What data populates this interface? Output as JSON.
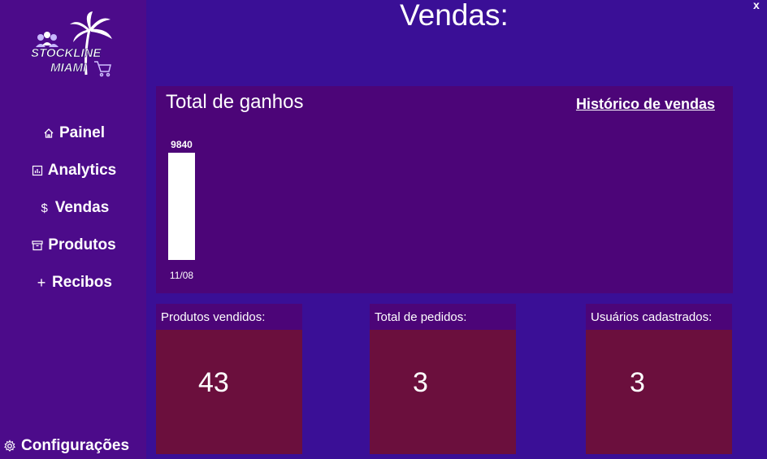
{
  "header": {
    "title": "Vendas:",
    "close_label": "x"
  },
  "logo": {
    "line1": "STOCKLINE",
    "line2": "MIAMI"
  },
  "sidebar": {
    "items": [
      {
        "label": "Painel",
        "icon": "home-icon"
      },
      {
        "label": "Analytics",
        "icon": "bar-chart-icon"
      },
      {
        "label": "Vendas",
        "icon": "dollar-icon"
      },
      {
        "label": "Produtos",
        "icon": "archive-box-icon"
      },
      {
        "label": "Recibos",
        "icon": "plus-icon"
      }
    ],
    "settings_label": "Configurações",
    "settings_icon": "gear-icon"
  },
  "earnings": {
    "title": "Total de ganhos",
    "history_link": "Histórico de vendas"
  },
  "chart_data": {
    "type": "bar",
    "categories": [
      "11/08"
    ],
    "values": [
      9840
    ],
    "data_labels": [
      "9840"
    ],
    "title": "Total de ganhos",
    "xlabel": "",
    "ylabel": "",
    "bar_color": "#ffffff"
  },
  "stats": [
    {
      "label": "Produtos vendidos:",
      "value": "43"
    },
    {
      "label": "Total de pedidos:",
      "value": "3"
    },
    {
      "label": "Usuários cadastrados:",
      "value": "3"
    }
  ],
  "colors": {
    "background": "#3a0f96",
    "sidebar": "#4c0b8a",
    "panel": "#4c0578",
    "stat_box": "#6b0f3d"
  }
}
